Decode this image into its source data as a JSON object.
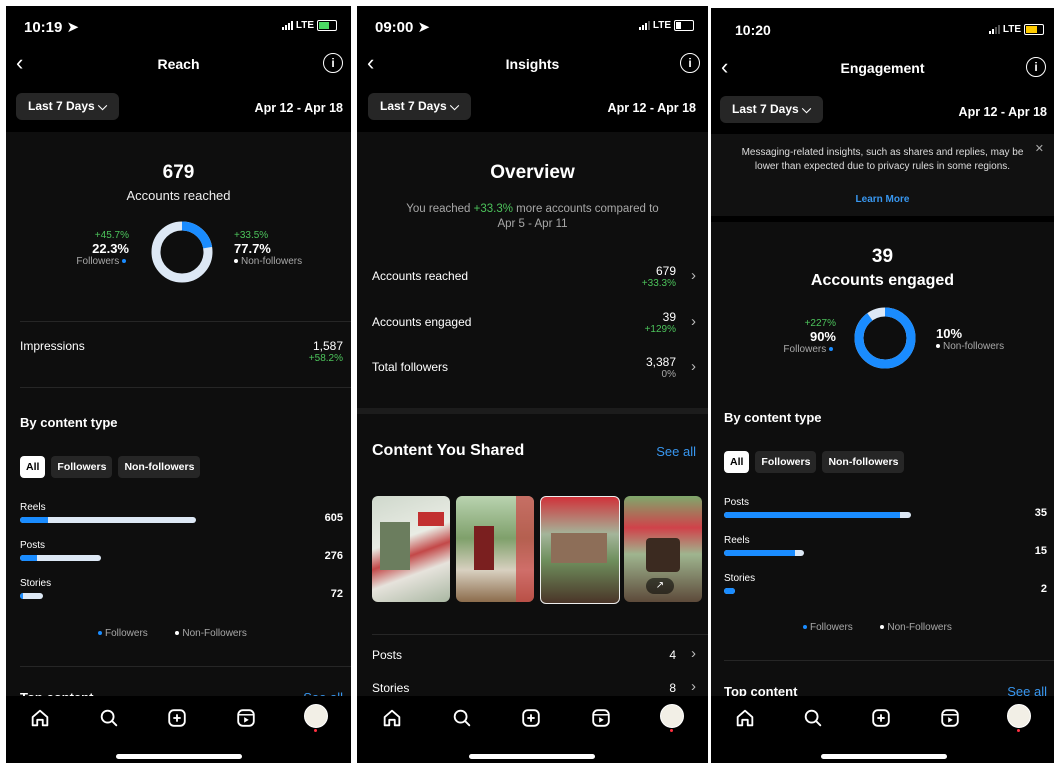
{
  "colors": {
    "accent_blue": "#1a8cff",
    "light_bar": "#dde8f5",
    "green": "#4cc35b",
    "link": "#3897f0"
  },
  "screen1": {
    "status": {
      "time": "10:19 ➤",
      "network": "LTE"
    },
    "header": {
      "title": "Reach"
    },
    "range": {
      "button": "Last 7 Days ⌵",
      "dates": "Apr 12 - Apr 18"
    },
    "summary": {
      "count": "679",
      "label": "Accounts reached",
      "followers": {
        "change": "+45.7%",
        "pct": "22.3%",
        "label": "Followers"
      },
      "nonfollowers": {
        "change": "+33.5%",
        "pct": "77.7%",
        "label": "Non-followers"
      },
      "followers_share": 0.223
    },
    "impressions": {
      "label": "Impressions",
      "value": "1,587",
      "change": "+58.2%"
    },
    "by_content": {
      "title": "By content type",
      "tabs": [
        "All",
        "Followers",
        "Non-followers"
      ],
      "items": [
        {
          "label": "Reels",
          "value": "605",
          "followers_frac": 0.16,
          "total_frac": 1.0
        },
        {
          "label": "Posts",
          "value": "276",
          "followers_frac": 0.21,
          "total_frac": 0.46
        },
        {
          "label": "Stories",
          "value": "72",
          "followers_frac": 0.11,
          "total_frac": 0.13
        }
      ],
      "legend": [
        "Followers",
        "Non-Followers"
      ]
    },
    "top": {
      "title": "Top content",
      "see_all": "See all"
    }
  },
  "screen2": {
    "status": {
      "time": "09:00 ➤",
      "network": "LTE"
    },
    "header": {
      "title": "Insights"
    },
    "range": {
      "button": "Last 7 Days ⌵",
      "dates": "Apr 12 - Apr 18"
    },
    "overview": {
      "title": "Overview",
      "text_pre": "You reached ",
      "text_change": "+33.3%",
      "text_post": " more accounts compared to",
      "text_dates": "Apr 5 - Apr 11"
    },
    "rows": [
      {
        "label": "Accounts reached",
        "value": "679",
        "change": "+33.3%"
      },
      {
        "label": "Accounts engaged",
        "value": "39",
        "change": "+129%"
      },
      {
        "label": "Total followers",
        "value": "3,387",
        "change": "0%"
      }
    ],
    "shared": {
      "title": "Content You Shared",
      "see_all": "See all"
    },
    "counts": [
      {
        "label": "Posts",
        "value": "4"
      },
      {
        "label": "Stories",
        "value": "8"
      }
    ]
  },
  "screen3": {
    "status": {
      "time": "10:20",
      "network": "LTE"
    },
    "header": {
      "title": "Engagement"
    },
    "range": {
      "button": "Last 7 Days ⌵",
      "dates": "Apr 12 - Apr 18"
    },
    "notice": {
      "text": "Messaging-related insights, such as shares and replies, may be lower than expected due to privacy rules in some regions.",
      "link": "Learn More"
    },
    "summary": {
      "count": "39",
      "label": "Accounts engaged",
      "followers": {
        "change": "+227%",
        "pct": "90%",
        "label": "Followers"
      },
      "nonfollowers": {
        "pct": "10%",
        "label": "Non-followers"
      },
      "followers_share": 0.9
    },
    "by_content": {
      "title": "By content type",
      "tabs": [
        "All",
        "Followers",
        "Non-followers"
      ],
      "items": [
        {
          "label": "Posts",
          "value": "35",
          "followers_frac": 0.94,
          "total_frac": 1.0
        },
        {
          "label": "Reels",
          "value": "15",
          "followers_frac": 0.89,
          "total_frac": 0.43
        },
        {
          "label": "Stories",
          "value": "2",
          "followers_frac": 1.0,
          "total_frac": 0.06
        }
      ],
      "legend": [
        "Followers",
        "Non-Followers"
      ]
    },
    "top": {
      "title": "Top content",
      "see_all": "See all"
    }
  },
  "nav": {
    "icons": [
      "home-icon",
      "search-icon",
      "create-icon",
      "reels-icon",
      "profile-avatar"
    ]
  }
}
